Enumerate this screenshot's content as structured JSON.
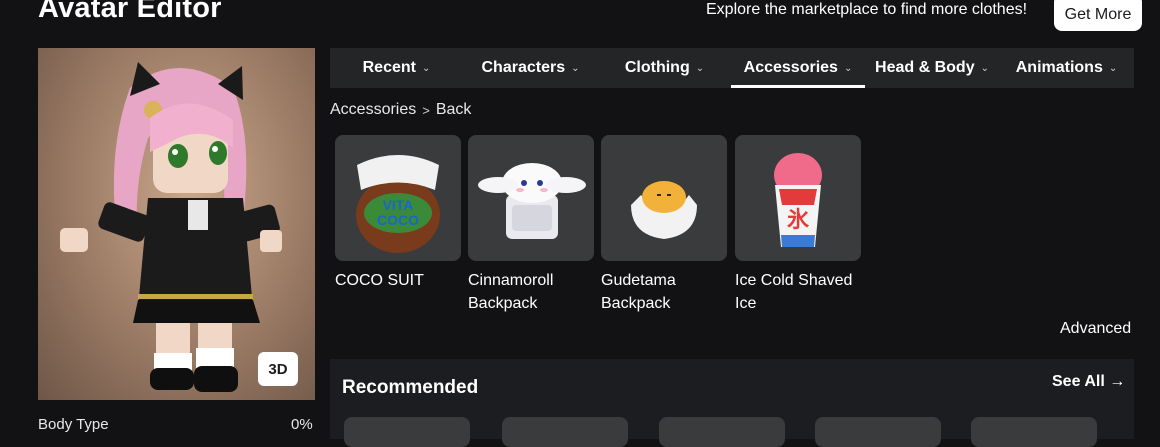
{
  "header": {
    "title": "Avatar Editor",
    "promo_text": "Explore the marketplace to find more clothes!",
    "get_more_label": "Get More"
  },
  "preview": {
    "view_toggle_label": "3D",
    "body_type_label": "Body Type",
    "body_type_value": "0%"
  },
  "tabs": [
    {
      "label": "Recent",
      "active": false
    },
    {
      "label": "Characters",
      "active": false
    },
    {
      "label": "Clothing",
      "active": false
    },
    {
      "label": "Accessories",
      "active": true
    },
    {
      "label": "Head & Body",
      "active": false
    },
    {
      "label": "Animations",
      "active": false
    }
  ],
  "breadcrumb": {
    "section": "Accessories",
    "current": "Back"
  },
  "items": [
    {
      "name": "COCO SUIT",
      "icon": "coconut-hat-icon"
    },
    {
      "name": "Cinnamoroll Backpack",
      "icon": "cinnamoroll-backpack-icon"
    },
    {
      "name": "Gudetama Backpack",
      "icon": "gudetama-egg-icon"
    },
    {
      "name": "Ice Cold Shaved Ice",
      "icon": "shaved-ice-cup-icon"
    }
  ],
  "advanced_label": "Advanced",
  "recommended": {
    "title": "Recommended",
    "see_all_label": "See All"
  },
  "colors": {
    "background": "#121215",
    "tabbar": "#232527",
    "card": "#393b3d",
    "accent_white": "#ffffff"
  }
}
